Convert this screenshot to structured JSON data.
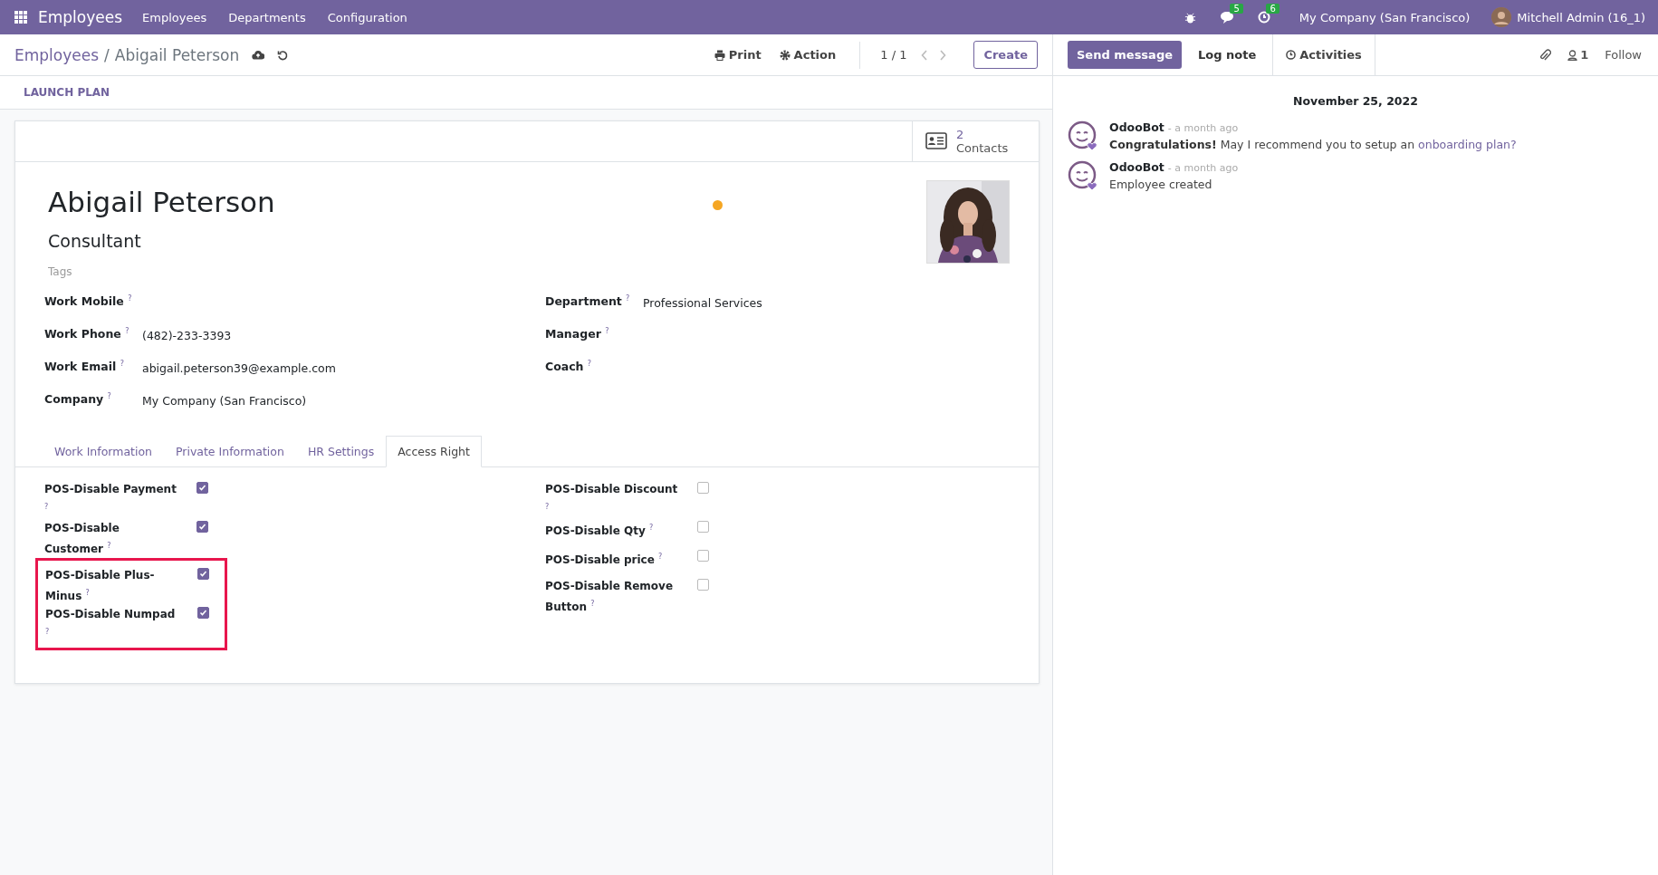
{
  "navbar": {
    "app": "Employees",
    "menus": [
      "Employees",
      "Departments",
      "Configuration"
    ],
    "message_count": "5",
    "activity_count": "6",
    "company": "My Company (San Francisco)",
    "user": "Mitchell Admin (16_1)"
  },
  "breadcrumb": {
    "parent": "Employees",
    "separator": "/",
    "current": "Abigail Peterson"
  },
  "actions": {
    "print": "Print",
    "action": "Action",
    "pager": "1 / 1",
    "create": "Create"
  },
  "header_buttons": [
    "LAUNCH PLAN"
  ],
  "smart_button": {
    "count": "2",
    "label": "Contacts"
  },
  "employee": {
    "name": "Abigail Peterson",
    "job_title": "Consultant",
    "presence_dot": {
      "color": "#f5a623"
    },
    "tags": {
      "placeholder": "Tags"
    }
  },
  "fields_left": [
    {
      "label": "Work Mobile $^{?}$"
    },
    {
      "label": "Work Phone $^{?}$",
      "value": "(482)-233-3393"
    },
    {
      "label": "Work Email $^{?}$",
      "value": "abigail.peterson39@example.com"
    },
    {
      "label": "Company $^{?}$",
      "value": "My Company (San Francisco)"
    }
  ],
  "fields_right": [
    {
      "label": "Department $^{?}$",
      "value": "Professional Services"
    },
    {
      "label": "Manager $^{?}$"
    },
    {
      "label": "Coach $^{?}$"
    }
  ],
  "tabs": [
    {
      "label": "Work Information",
      "selected": false
    },
    {
      "label": "Private Information",
      "selected": false
    },
    {
      "label": "HR Settings",
      "selected": false
    },
    {
      "label": "Access Right",
      "selected": true
    }
  ],
  "access_left": [
    {
      "label": "POS-Disable Payment $^{?}$",
      "checked": true,
      "highlighted": false
    },
    {
      "label": "POS-Disable Customer $^{?}$",
      "checked": true,
      "highlighted": false
    },
    {
      "label": "POS-Disable Plus-Minus $^{?}$",
      "checked": true,
      "highlighted": true
    },
    {
      "label": "POS-Disable Numpad $^{?}$",
      "checked": true,
      "highlighted": true
    }
  ],
  "access_right": [
    {
      "label": "POS-Disable Discount $^{?}$",
      "checked": false,
      "highlighted": false
    },
    {
      "label": "POS-Disable Qty $^{?}$",
      "checked": false,
      "highlighted": false
    },
    {
      "label": "POS-Disable price $^{?}$",
      "checked": false,
      "highlighted": false
    },
    {
      "label": "POS-Disable Remove Button $^{?}$",
      "checked": false,
      "highlighted": false
    }
  ],
  "chatter": {
    "send_message": "Send message",
    "log_note": "Log note",
    "activities": "Activities",
    "followers": "1",
    "follow": "Follow",
    "date": "November 25, 2022",
    "messages": [
      {
        "author": "OdooBot",
        "time": "- a month ago",
        "body": "**Congratulations!** May I recommend you to setup an ",
        "link": "onboarding plan?"
      },
      {
        "author": "OdooBot",
        "time": "- a month ago",
        "body": "Employee created"
      }
    ]
  }
}
